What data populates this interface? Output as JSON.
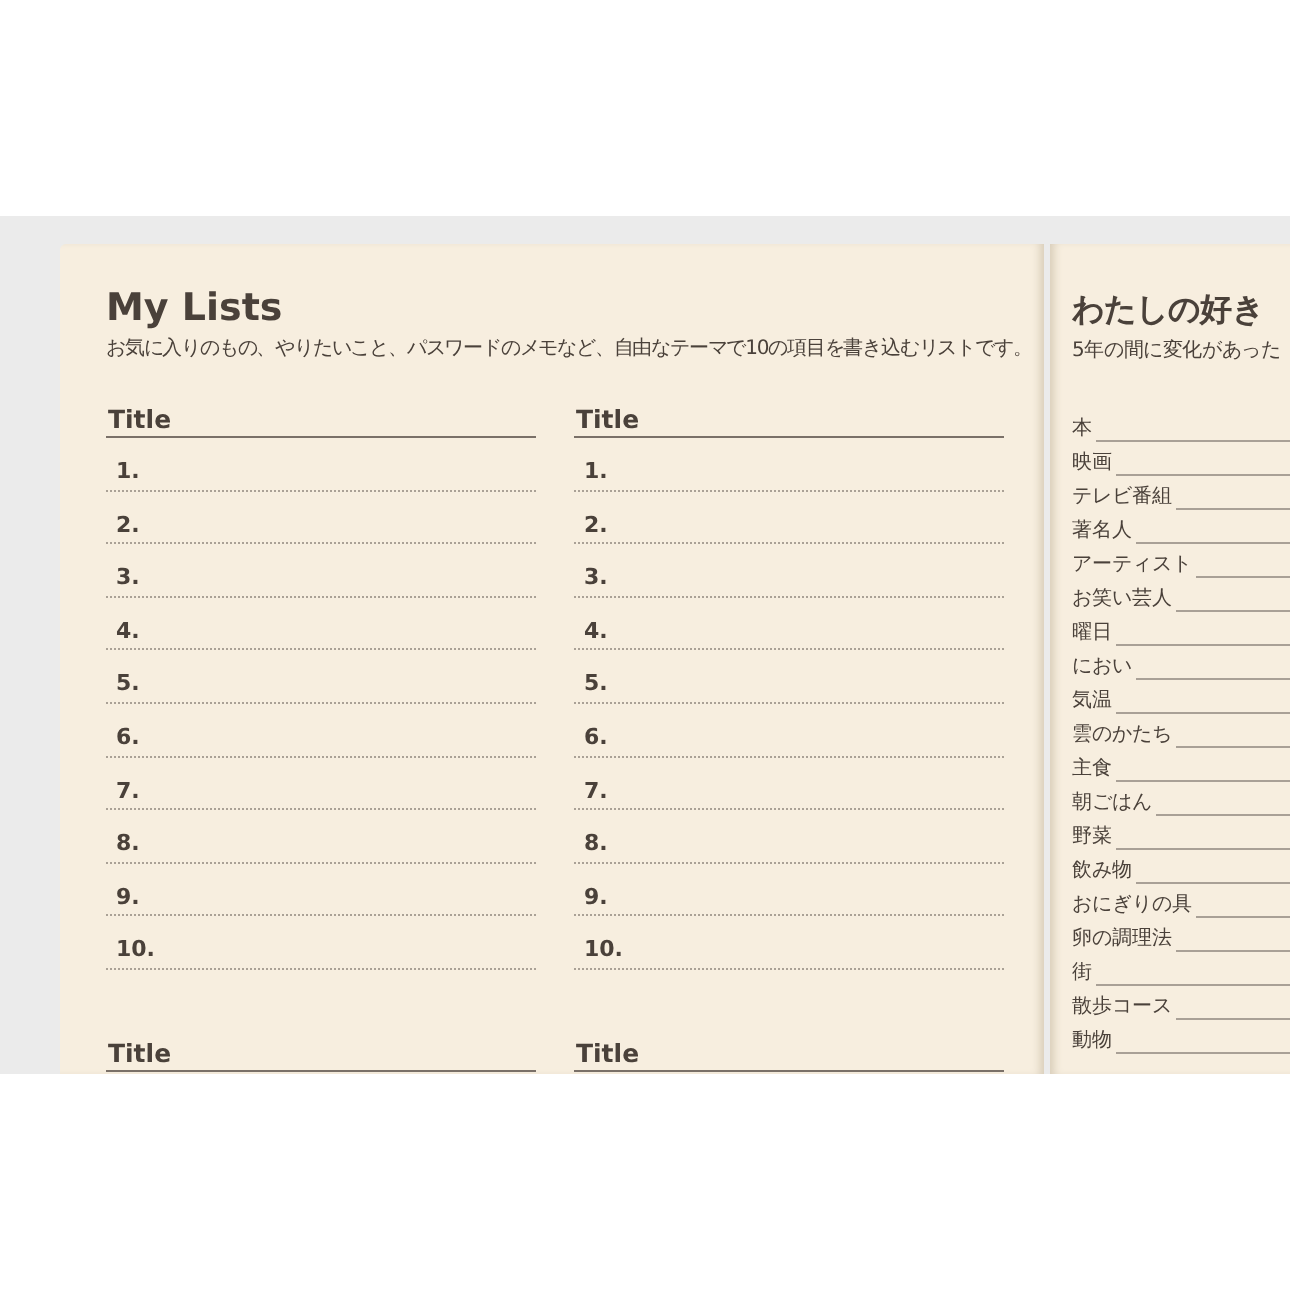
{
  "left_page": {
    "title": "My Lists",
    "subtitle": "お気に入りのもの、やりたいこと、パスワードのメモなど、自由なテーマで10の項目を書き込むリストです。",
    "lists": [
      {
        "title": "Title",
        "items": [
          "1.",
          "2.",
          "3.",
          "4.",
          "5.",
          "6.",
          "7.",
          "8.",
          "9.",
          "10."
        ]
      },
      {
        "title": "Title",
        "items": [
          "1.",
          "2.",
          "3.",
          "4.",
          "5.",
          "6.",
          "7.",
          "8.",
          "9.",
          "10."
        ]
      },
      {
        "title": "Title"
      },
      {
        "title": "Title"
      }
    ]
  },
  "right_page": {
    "title": "わたしの好き",
    "subtitle": "5年の間に変化があった",
    "items": [
      "本",
      "映画",
      "テレビ番組",
      "著名人",
      "アーティスト",
      "お笑い芸人",
      "曜日",
      "におい",
      "気温",
      "雲のかたち",
      "主食",
      "朝ごはん",
      "野菜",
      "飲み物",
      "おにぎりの具",
      "卵の調理法",
      "街",
      "散歩コース",
      "動物"
    ]
  }
}
